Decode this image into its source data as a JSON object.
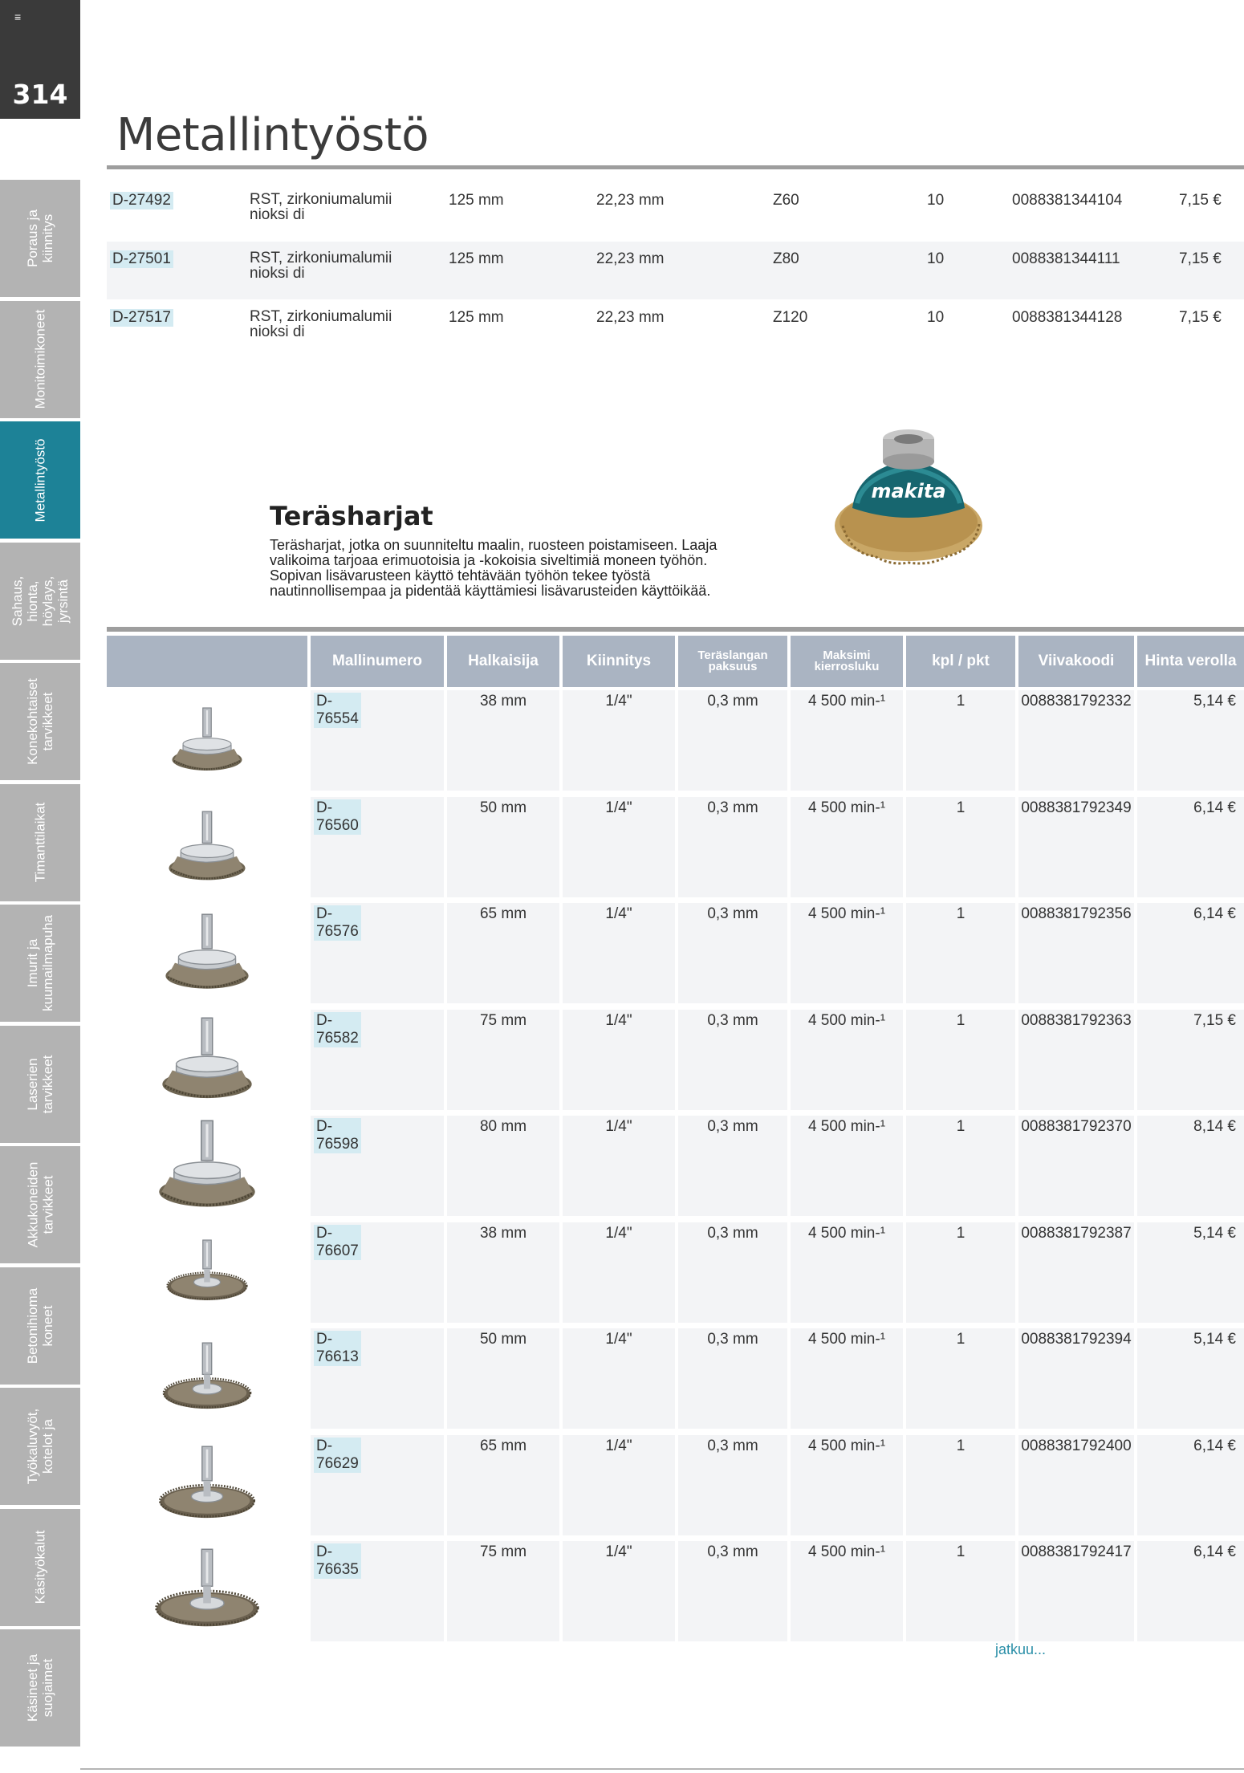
{
  "page_number": "314",
  "page_title": "Metallintyöstö",
  "sidebar": {
    "tabs": [
      {
        "label": "Poraus ja kiinnitys",
        "active": false
      },
      {
        "label": "Monitoimikoneet",
        "active": false
      },
      {
        "label": "Metallintyöstö",
        "active": true
      },
      {
        "label": "Sahaus, hionta, höylays, jyrsintä",
        "active": false
      },
      {
        "label": "Konekohtaiset tarvikkeet",
        "active": false
      },
      {
        "label": "Timanttilaikat",
        "active": false
      },
      {
        "label": "Imurit ja kuumailmapuha",
        "active": false
      },
      {
        "label": "Laserien tarvikkeet",
        "active": false
      },
      {
        "label": "Akkukoneiden tarvikkeet",
        "active": false
      },
      {
        "label": "Betonihioma koneet",
        "active": false
      },
      {
        "label": "Työkaluvyöt, kotelot ja",
        "active": false
      },
      {
        "label": "Käsityökalut",
        "active": false
      },
      {
        "label": "Käsineet ja suojaimet",
        "active": false
      }
    ]
  },
  "top_table": {
    "rows": [
      {
        "code": "D-27492",
        "material": "RST, zirkoniumalumiinioksi di",
        "diameter": "125 mm",
        "bore": "22,23 mm",
        "grit": "Z60",
        "qty": "10",
        "ean": "0088381344104",
        "price": "7,15 €"
      },
      {
        "code": "D-27501",
        "material": "RST, zirkoniumalumiinioksi di",
        "diameter": "125 mm",
        "bore": "22,23 mm",
        "grit": "Z80",
        "qty": "10",
        "ean": "0088381344111",
        "price": "7,15 €"
      },
      {
        "code": "D-27517",
        "material": "RST, zirkoniumalumiinioksi di",
        "diameter": "125 mm",
        "bore": "22,23 mm",
        "grit": "Z120",
        "qty": "10",
        "ean": "0088381344128",
        "price": "7,15 €"
      }
    ]
  },
  "section": {
    "title": "Teräsharjat",
    "description": "Teräsharjat, jotka on suunniteltu maalin, ruosteen poistamiseen. Laaja valikoima tarjoaa erimuotoisia ja -kokoisia siveltimiä moneen työhön. Sopivan lisävarusteen käyttö tehtävään työhön tekee työstä nautinnollisempaa ja pidentää käyttämiesi lisävarusteiden käyttöikää.",
    "product_logo": "makita"
  },
  "brush_table": {
    "headers": [
      "Mallinumero",
      "Halkaisija",
      "Kiinnitys",
      "Teräslangan paksuus",
      "Maksimi kierrosluku",
      "kpl / pkt",
      "Viivakoodi",
      "Hinta verolla"
    ],
    "rows": [
      {
        "code": "D-76554",
        "diameter": "38 mm",
        "mount": "1/4\"",
        "wire": "0,3 mm",
        "speed": "4 500 min-¹",
        "qty": "1",
        "ean": "0088381792332",
        "price": "5,14 €",
        "brush_type": "cup"
      },
      {
        "code": "D-76560",
        "diameter": "50 mm",
        "mount": "1/4\"",
        "wire": "0,3 mm",
        "speed": "4 500 min-¹",
        "qty": "1",
        "ean": "0088381792349",
        "price": "6,14 €",
        "brush_type": "cup"
      },
      {
        "code": "D-76576",
        "diameter": "65 mm",
        "mount": "1/4\"",
        "wire": "0,3 mm",
        "speed": "4 500 min-¹",
        "qty": "1",
        "ean": "0088381792356",
        "price": "6,14 €",
        "brush_type": "cup"
      },
      {
        "code": "D-76582",
        "diameter": "75 mm",
        "mount": "1/4\"",
        "wire": "0,3 mm",
        "speed": "4 500 min-¹",
        "qty": "1",
        "ean": "0088381792363",
        "price": "7,15 €",
        "brush_type": "cup"
      },
      {
        "code": "D-76598",
        "diameter": "80 mm",
        "mount": "1/4\"",
        "wire": "0,3 mm",
        "speed": "4 500 min-¹",
        "qty": "1",
        "ean": "0088381792370",
        "price": "8,14 €",
        "brush_type": "cup"
      },
      {
        "code": "D-76607",
        "diameter": "38 mm",
        "mount": "1/4\"",
        "wire": "0,3 mm",
        "speed": "4 500 min-¹",
        "qty": "1",
        "ean": "0088381792387",
        "price": "5,14 €",
        "brush_type": "wheel"
      },
      {
        "code": "D-76613",
        "diameter": "50 mm",
        "mount": "1/4\"",
        "wire": "0,3 mm",
        "speed": "4 500 min-¹",
        "qty": "1",
        "ean": "0088381792394",
        "price": "5,14 €",
        "brush_type": "wheel"
      },
      {
        "code": "D-76629",
        "diameter": "65 mm",
        "mount": "1/4\"",
        "wire": "0,3 mm",
        "speed": "4 500 min-¹",
        "qty": "1",
        "ean": "0088381792400",
        "price": "6,14 €",
        "brush_type": "wheel"
      },
      {
        "code": "D-76635",
        "diameter": "75 mm",
        "mount": "1/4\"",
        "wire": "0,3 mm",
        "speed": "4 500 min-¹",
        "qty": "1",
        "ean": "0088381792417",
        "price": "6,14 €",
        "brush_type": "wheel"
      }
    ]
  },
  "continue_text": "jatkuu...",
  "colors": {
    "accent": "#1d8297",
    "header": "#aab4c2",
    "sidebar_inactive": "#b3b3b3",
    "code_highlight": "#d4ebf2"
  }
}
